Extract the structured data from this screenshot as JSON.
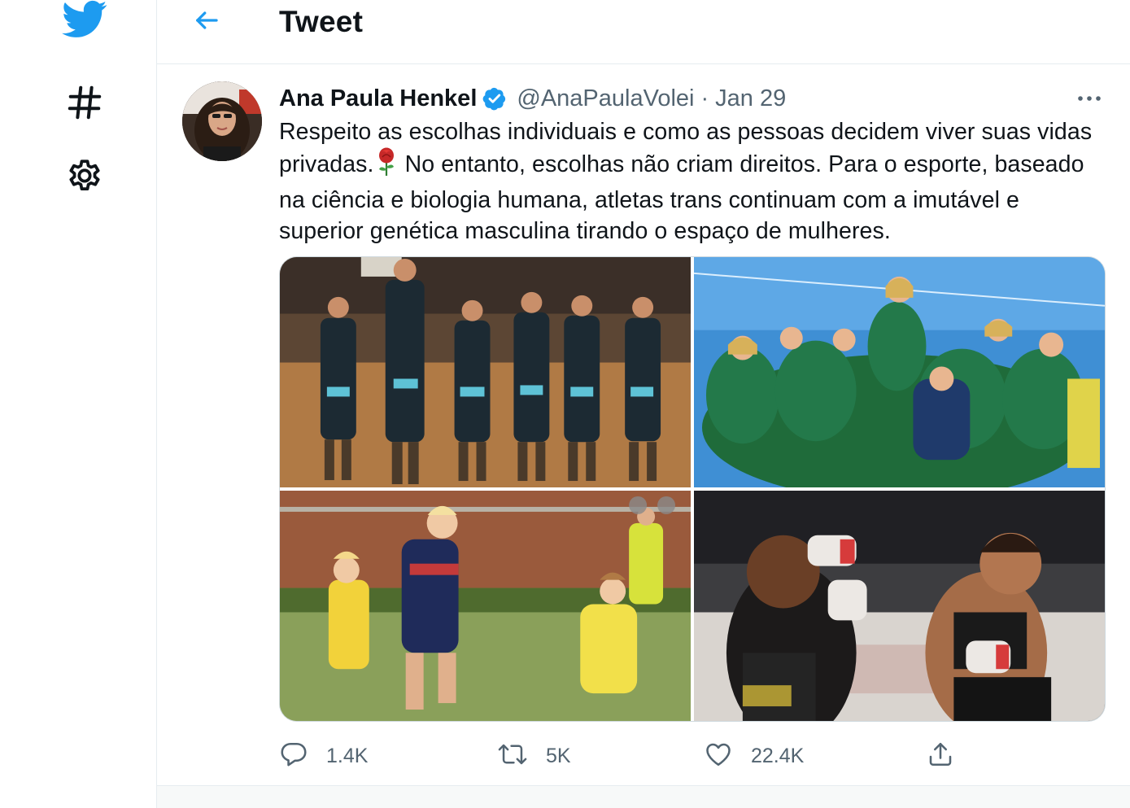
{
  "colors": {
    "brand": "#1d9bf0",
    "text_primary": "#0f1419",
    "text_secondary": "#536471",
    "border": "#e6ecf0"
  },
  "nav": {
    "items": [
      {
        "icon": "twitter-bird-icon"
      },
      {
        "icon": "hashtag-icon"
      },
      {
        "icon": "gear-icon"
      }
    ]
  },
  "header": {
    "title": "Tweet",
    "back_icon": "arrow-left-icon"
  },
  "tweet": {
    "author_name": "Ana Paula Henkel",
    "verified": true,
    "handle": "@AnaPaulaVolei",
    "separator": "·",
    "date": "Jan 29",
    "more_icon": "more-dots-icon",
    "text_part1": "Respeito as escolhas individuais e como as pessoas decidem viver suas vidas privadas.",
    "emoji": "rose-emoji",
    "text_part2": " No entanto, escolhas não criam direitos. Para o esporte, baseado na ciência e biologia humana, atletas trans continuam com a imutável e superior genética masculina tirando o espaço de mulheres.",
    "media": [
      {
        "icon": "photo-basketball-team"
      },
      {
        "icon": "photo-handball-team-celebration"
      },
      {
        "icon": "photo-australian-football-match"
      },
      {
        "icon": "photo-mma-fight"
      }
    ],
    "actions": {
      "reply_count": "1.4K",
      "retweet_count": "5K",
      "like_count": "22.4K"
    }
  }
}
